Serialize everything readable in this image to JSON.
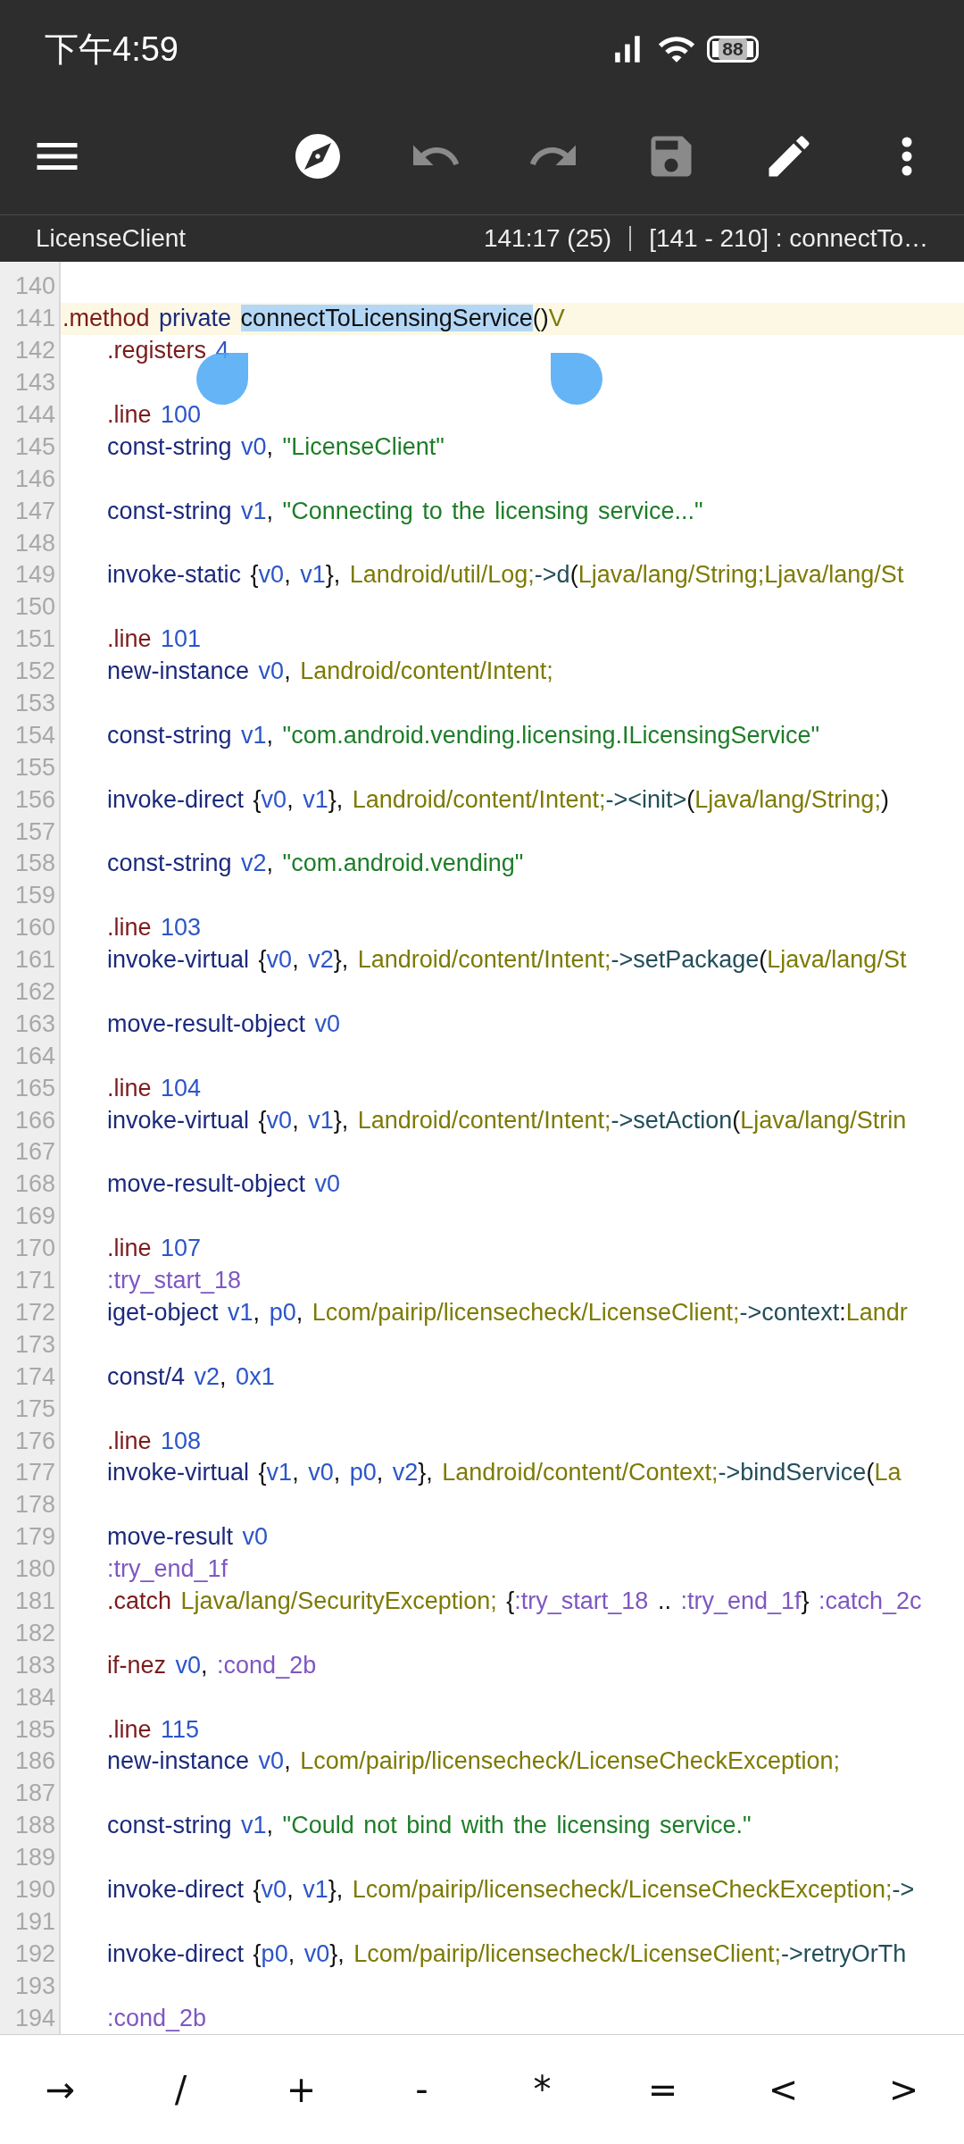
{
  "status_bar": {
    "time": "下午4:59",
    "battery": "88"
  },
  "toolbar": [
    {
      "kind": "menu",
      "disabled": false
    },
    {
      "kind": "navigate",
      "disabled": false
    },
    {
      "kind": "undo",
      "disabled": true
    },
    {
      "kind": "redo",
      "disabled": true
    },
    {
      "kind": "save",
      "disabled": true
    },
    {
      "kind": "edit",
      "disabled": false
    },
    {
      "kind": "more",
      "disabled": false
    }
  ],
  "info_bar": {
    "file": "LicenseClient",
    "cursor": "141:17 (25)",
    "range": "[141 - 210] : connectTo…"
  },
  "editor": {
    "lines": [
      {
        "number": "140",
        "current": false
      },
      {
        "number": "141",
        "current": true,
        "indented": false,
        "tokens": [
          {
            "kind": "dir",
            "text": ".method "
          },
          {
            "kind": "op",
            "text": "private "
          },
          {
            "kind": "selection",
            "text": "connectToLicensingService"
          },
          {
            "kind": "plain",
            "text": "()"
          },
          {
            "kind": "type",
            "text": "V"
          }
        ]
      },
      {
        "number": "142",
        "current": false,
        "indented": true,
        "tokens": [
          {
            "kind": "dir",
            "text": ".registers "
          },
          {
            "kind": "num",
            "text": "4"
          }
        ]
      },
      {
        "number": "143",
        "current": false
      },
      {
        "number": "144",
        "current": false,
        "indented": true,
        "tokens": [
          {
            "kind": "dir",
            "text": ".line "
          },
          {
            "kind": "num",
            "text": "100"
          }
        ]
      },
      {
        "number": "145",
        "current": false,
        "indented": true,
        "tokens": [
          {
            "kind": "op",
            "text": "const-string "
          },
          {
            "kind": "reg",
            "text": "v0"
          },
          {
            "kind": "plain",
            "text": ", "
          },
          {
            "kind": "str",
            "text": "\"LicenseClient\""
          }
        ]
      },
      {
        "number": "146",
        "current": false
      },
      {
        "number": "147",
        "current": false,
        "indented": true,
        "tokens": [
          {
            "kind": "op",
            "text": "const-string "
          },
          {
            "kind": "reg",
            "text": "v1"
          },
          {
            "kind": "plain",
            "text": ", "
          },
          {
            "kind": "str",
            "text": "\"Connecting to the licensing service...\""
          }
        ]
      },
      {
        "number": "148",
        "current": false
      },
      {
        "number": "149",
        "current": false,
        "indented": true,
        "tokens": [
          {
            "kind": "op",
            "text": "invoke-static "
          },
          {
            "kind": "plain",
            "text": "{"
          },
          {
            "kind": "reg",
            "text": "v0"
          },
          {
            "kind": "plain",
            "text": ", "
          },
          {
            "kind": "reg",
            "text": "v1"
          },
          {
            "kind": "plain",
            "text": "}, "
          },
          {
            "kind": "type",
            "text": "Landroid/util/Log;"
          },
          {
            "kind": "member",
            "text": "->d"
          },
          {
            "kind": "plain",
            "text": "("
          },
          {
            "kind": "type",
            "text": "Ljava/lang/String;Ljava/lang/St"
          }
        ]
      },
      {
        "number": "150",
        "current": false
      },
      {
        "number": "151",
        "current": false,
        "indented": true,
        "tokens": [
          {
            "kind": "dir",
            "text": ".line "
          },
          {
            "kind": "num",
            "text": "101"
          }
        ]
      },
      {
        "number": "152",
        "current": false,
        "indented": true,
        "tokens": [
          {
            "kind": "op",
            "text": "new-instance "
          },
          {
            "kind": "reg",
            "text": "v0"
          },
          {
            "kind": "plain",
            "text": ", "
          },
          {
            "kind": "type",
            "text": "Landroid/content/Intent;"
          }
        ]
      },
      {
        "number": "153",
        "current": false
      },
      {
        "number": "154",
        "current": false,
        "indented": true,
        "tokens": [
          {
            "kind": "op",
            "text": "const-string "
          },
          {
            "kind": "reg",
            "text": "v1"
          },
          {
            "kind": "plain",
            "text": ", "
          },
          {
            "kind": "str",
            "text": "\"com.android.vending.licensing.ILicensingService\""
          }
        ]
      },
      {
        "number": "155",
        "current": false
      },
      {
        "number": "156",
        "current": false,
        "indented": true,
        "tokens": [
          {
            "kind": "op",
            "text": "invoke-direct "
          },
          {
            "kind": "plain",
            "text": "{"
          },
          {
            "kind": "reg",
            "text": "v0"
          },
          {
            "kind": "plain",
            "text": ", "
          },
          {
            "kind": "reg",
            "text": "v1"
          },
          {
            "kind": "plain",
            "text": "}, "
          },
          {
            "kind": "type",
            "text": "Landroid/content/Intent;"
          },
          {
            "kind": "member",
            "text": "-><init>"
          },
          {
            "kind": "plain",
            "text": "("
          },
          {
            "kind": "type",
            "text": "Ljava/lang/String;"
          },
          {
            "kind": "plain",
            "text": ")"
          }
        ]
      },
      {
        "number": "157",
        "current": false
      },
      {
        "number": "158",
        "current": false,
        "indented": true,
        "tokens": [
          {
            "kind": "op",
            "text": "const-string "
          },
          {
            "kind": "reg",
            "text": "v2"
          },
          {
            "kind": "plain",
            "text": ", "
          },
          {
            "kind": "str",
            "text": "\"com.android.vending\""
          }
        ]
      },
      {
        "number": "159",
        "current": false
      },
      {
        "number": "160",
        "current": false,
        "indented": true,
        "tokens": [
          {
            "kind": "dir",
            "text": ".line "
          },
          {
            "kind": "num",
            "text": "103"
          }
        ]
      },
      {
        "number": "161",
        "current": false,
        "indented": true,
        "tokens": [
          {
            "kind": "op",
            "text": "invoke-virtual "
          },
          {
            "kind": "plain",
            "text": "{"
          },
          {
            "kind": "reg",
            "text": "v0"
          },
          {
            "kind": "plain",
            "text": ", "
          },
          {
            "kind": "reg",
            "text": "v2"
          },
          {
            "kind": "plain",
            "text": "}, "
          },
          {
            "kind": "type",
            "text": "Landroid/content/Intent;"
          },
          {
            "kind": "member",
            "text": "->setPackage"
          },
          {
            "kind": "plain",
            "text": "("
          },
          {
            "kind": "type",
            "text": "Ljava/lang/St"
          }
        ]
      },
      {
        "number": "162",
        "current": false
      },
      {
        "number": "163",
        "current": false,
        "indented": true,
        "tokens": [
          {
            "kind": "op",
            "text": "move-result-object "
          },
          {
            "kind": "reg",
            "text": "v0"
          }
        ]
      },
      {
        "number": "164",
        "current": false
      },
      {
        "number": "165",
        "current": false,
        "indented": true,
        "tokens": [
          {
            "kind": "dir",
            "text": ".line "
          },
          {
            "kind": "num",
            "text": "104"
          }
        ]
      },
      {
        "number": "166",
        "current": false,
        "indented": true,
        "tokens": [
          {
            "kind": "op",
            "text": "invoke-virtual "
          },
          {
            "kind": "plain",
            "text": "{"
          },
          {
            "kind": "reg",
            "text": "v0"
          },
          {
            "kind": "plain",
            "text": ", "
          },
          {
            "kind": "reg",
            "text": "v1"
          },
          {
            "kind": "plain",
            "text": "}, "
          },
          {
            "kind": "type",
            "text": "Landroid/content/Intent;"
          },
          {
            "kind": "member",
            "text": "->setAction"
          },
          {
            "kind": "plain",
            "text": "("
          },
          {
            "kind": "type",
            "text": "Ljava/lang/Strin"
          }
        ]
      },
      {
        "number": "167",
        "current": false
      },
      {
        "number": "168",
        "current": false,
        "indented": true,
        "tokens": [
          {
            "kind": "op",
            "text": "move-result-object "
          },
          {
            "kind": "reg",
            "text": "v0"
          }
        ]
      },
      {
        "number": "169",
        "current": false
      },
      {
        "number": "170",
        "current": false,
        "indented": true,
        "tokens": [
          {
            "kind": "dir",
            "text": ".line "
          },
          {
            "kind": "num",
            "text": "107"
          }
        ]
      },
      {
        "number": "171",
        "current": false,
        "indented": true,
        "tokens": [
          {
            "kind": "label",
            "text": ":try_start_18"
          }
        ]
      },
      {
        "number": "172",
        "current": false,
        "indented": true,
        "tokens": [
          {
            "kind": "op",
            "text": "iget-object "
          },
          {
            "kind": "reg",
            "text": "v1"
          },
          {
            "kind": "plain",
            "text": ", "
          },
          {
            "kind": "reg",
            "text": "p0"
          },
          {
            "kind": "plain",
            "text": ", "
          },
          {
            "kind": "type",
            "text": "Lcom/pairip/licensecheck/LicenseClient;"
          },
          {
            "kind": "member",
            "text": "->context"
          },
          {
            "kind": "plain",
            "text": ":"
          },
          {
            "kind": "type",
            "text": "Landr"
          }
        ]
      },
      {
        "number": "173",
        "current": false
      },
      {
        "number": "174",
        "current": false,
        "indented": true,
        "tokens": [
          {
            "kind": "op",
            "text": "const/4 "
          },
          {
            "kind": "reg",
            "text": "v2"
          },
          {
            "kind": "plain",
            "text": ", "
          },
          {
            "kind": "num",
            "text": "0x1"
          }
        ]
      },
      {
        "number": "175",
        "current": false
      },
      {
        "number": "176",
        "current": false,
        "indented": true,
        "tokens": [
          {
            "kind": "dir",
            "text": ".line "
          },
          {
            "kind": "num",
            "text": "108"
          }
        ]
      },
      {
        "number": "177",
        "current": false,
        "indented": true,
        "tokens": [
          {
            "kind": "op",
            "text": "invoke-virtual "
          },
          {
            "kind": "plain",
            "text": "{"
          },
          {
            "kind": "reg",
            "text": "v1"
          },
          {
            "kind": "plain",
            "text": ", "
          },
          {
            "kind": "reg",
            "text": "v0"
          },
          {
            "kind": "plain",
            "text": ", "
          },
          {
            "kind": "reg",
            "text": "p0"
          },
          {
            "kind": "plain",
            "text": ", "
          },
          {
            "kind": "reg",
            "text": "v2"
          },
          {
            "kind": "plain",
            "text": "}, "
          },
          {
            "kind": "type",
            "text": "Landroid/content/Context;"
          },
          {
            "kind": "member",
            "text": "->bindService"
          },
          {
            "kind": "plain",
            "text": "("
          },
          {
            "kind": "type",
            "text": "La"
          }
        ]
      },
      {
        "number": "178",
        "current": false
      },
      {
        "number": "179",
        "current": false,
        "indented": true,
        "tokens": [
          {
            "kind": "op",
            "text": "move-result "
          },
          {
            "kind": "reg",
            "text": "v0"
          }
        ]
      },
      {
        "number": "180",
        "current": false,
        "indented": true,
        "tokens": [
          {
            "kind": "label",
            "text": ":try_end_1f"
          }
        ]
      },
      {
        "number": "181",
        "current": false,
        "indented": true,
        "tokens": [
          {
            "kind": "dir",
            "text": ".catch "
          },
          {
            "kind": "type",
            "text": "Ljava/lang/SecurityException;"
          },
          {
            "kind": "plain",
            "text": " {"
          },
          {
            "kind": "label",
            "text": ":try_start_18"
          },
          {
            "kind": "plain",
            "text": " .. "
          },
          {
            "kind": "label",
            "text": ":try_end_1f"
          },
          {
            "kind": "plain",
            "text": "} "
          },
          {
            "kind": "label",
            "text": ":catch_2c"
          }
        ]
      },
      {
        "number": "182",
        "current": false
      },
      {
        "number": "183",
        "current": false,
        "indented": true,
        "tokens": [
          {
            "kind": "dir",
            "text": "if-nez "
          },
          {
            "kind": "reg",
            "text": "v0"
          },
          {
            "kind": "plain",
            "text": ", "
          },
          {
            "kind": "label",
            "text": ":cond_2b"
          }
        ]
      },
      {
        "number": "184",
        "current": false
      },
      {
        "number": "185",
        "current": false,
        "indented": true,
        "tokens": [
          {
            "kind": "dir",
            "text": ".line "
          },
          {
            "kind": "num",
            "text": "115"
          }
        ]
      },
      {
        "number": "186",
        "current": false,
        "indented": true,
        "tokens": [
          {
            "kind": "op",
            "text": "new-instance "
          },
          {
            "kind": "reg",
            "text": "v0"
          },
          {
            "kind": "plain",
            "text": ", "
          },
          {
            "kind": "type",
            "text": "Lcom/pairip/licensecheck/LicenseCheckException;"
          }
        ]
      },
      {
        "number": "187",
        "current": false
      },
      {
        "number": "188",
        "current": false,
        "indented": true,
        "tokens": [
          {
            "kind": "op",
            "text": "const-string "
          },
          {
            "kind": "reg",
            "text": "v1"
          },
          {
            "kind": "plain",
            "text": ", "
          },
          {
            "kind": "str",
            "text": "\"Could not bind with the licensing service.\""
          }
        ]
      },
      {
        "number": "189",
        "current": false
      },
      {
        "number": "190",
        "current": false,
        "indented": true,
        "tokens": [
          {
            "kind": "op",
            "text": "invoke-direct "
          },
          {
            "kind": "plain",
            "text": "{"
          },
          {
            "kind": "reg",
            "text": "v0"
          },
          {
            "kind": "plain",
            "text": ", "
          },
          {
            "kind": "reg",
            "text": "v1"
          },
          {
            "kind": "plain",
            "text": "}, "
          },
          {
            "kind": "type",
            "text": "Lcom/pairip/licensecheck/LicenseCheckException;"
          },
          {
            "kind": "member",
            "text": "->"
          }
        ]
      },
      {
        "number": "191",
        "current": false
      },
      {
        "number": "192",
        "current": false,
        "indented": true,
        "tokens": [
          {
            "kind": "op",
            "text": "invoke-direct "
          },
          {
            "kind": "plain",
            "text": "{"
          },
          {
            "kind": "reg",
            "text": "p0"
          },
          {
            "kind": "plain",
            "text": ", "
          },
          {
            "kind": "reg",
            "text": "v0"
          },
          {
            "kind": "plain",
            "text": "}, "
          },
          {
            "kind": "type",
            "text": "Lcom/pairip/licensecheck/LicenseClient;"
          },
          {
            "kind": "member",
            "text": "->retryOrTh"
          }
        ]
      },
      {
        "number": "193",
        "current": false
      },
      {
        "number": "194",
        "current": false,
        "indented": true,
        "tokens": [
          {
            "kind": "label",
            "text": ":cond_2b"
          }
        ]
      }
    ]
  },
  "keys": [
    "→",
    "/",
    "+",
    "-",
    "*",
    "=",
    "<",
    ">"
  ]
}
